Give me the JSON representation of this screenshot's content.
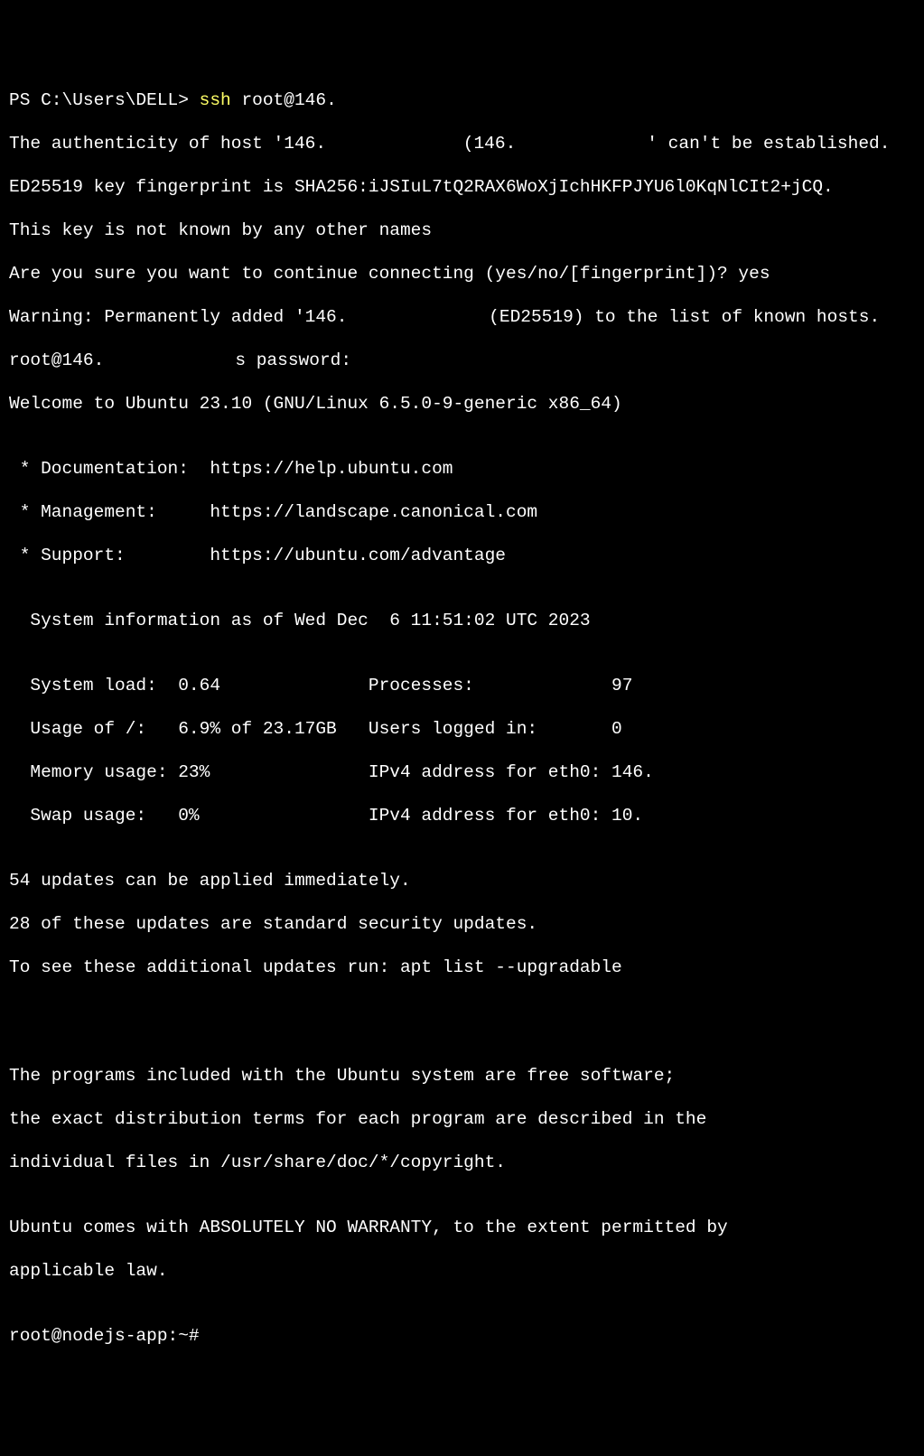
{
  "prompt": {
    "ps_prefix": "PS C:\\Users\\DELL> ",
    "ssh_command": "ssh",
    "ssh_target": " root@146."
  },
  "lines": {
    "l1a": "The authenticity of host '146.",
    "l1b": " (146.",
    "l1c": "' can't be established.",
    "l2": "ED25519 key fingerprint is SHA256:iJSIuL7tQ2RAX6WoXjIchHKFPJYU6l0KqNlCIt2+jCQ.",
    "l3": "This key is not known by any other names",
    "l4": "Are you sure you want to continue connecting (yes/no/[fingerprint])? yes",
    "l5a": "Warning: Permanently added '146.",
    "l5b": " (ED25519) to the list of known hosts.",
    "l6a": "root@146.",
    "l6b": "s password:",
    "l7": "Welcome to Ubuntu 23.10 (GNU/Linux 6.5.0-9-generic x86_64)",
    "l8": "",
    "l9": " * Documentation:  https://help.ubuntu.com",
    "l10": " * Management:     https://landscape.canonical.com",
    "l11": " * Support:        https://ubuntu.com/advantage",
    "l12": "",
    "l13": "  System information as of Wed Dec  6 11:51:02 UTC 2023",
    "l14": "",
    "l15": "  System load:  0.64              Processes:             97",
    "l16": "  Usage of /:   6.9% of 23.17GB   Users logged in:       0",
    "l17a": "  Memory usage: 23%               IPv4 address for eth0: 146.",
    "l18a": "  Swap usage:   0%                IPv4 address for eth0: 10.",
    "l19": "",
    "l20": "54 updates can be applied immediately.",
    "l21": "28 of these updates are standard security updates.",
    "l22": "To see these additional updates run: apt list --upgradable",
    "l23": "",
    "l24": "",
    "l25": "",
    "l26": "The programs included with the Ubuntu system are free software;",
    "l27": "the exact distribution terms for each program are described in the",
    "l28": "individual files in /usr/share/doc/*/copyright.",
    "l29": "",
    "l30": "Ubuntu comes with ABSOLUTELY NO WARRANTY, to the extent permitted by",
    "l31": "applicable law.",
    "l32": "",
    "l33": "root@nodejs-app:~#"
  }
}
